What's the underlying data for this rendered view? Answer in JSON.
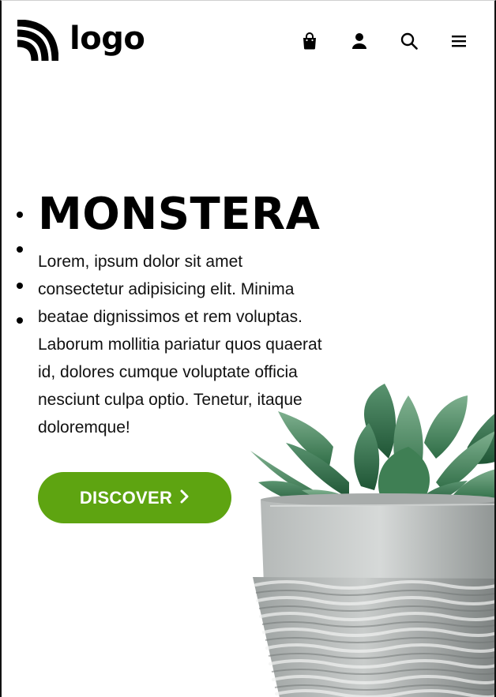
{
  "header": {
    "logo_text": "logo",
    "icons": [
      "shopping-bag-icon",
      "user-icon",
      "search-icon",
      "menu-icon"
    ]
  },
  "hero": {
    "title": "MONSTERA",
    "description": "Lorem, ipsum dolor sit amet consectetur adipisicing elit. Minima beatae dignissimos et rem voluptas. Laborum mollitia pariatur quos quaerat id, dolores cumque voluptate officia nesciunt culpa optio. Tenetur, itaque doloremque!",
    "button_label": "DISCOVER",
    "button_icon": "chevron-right-icon"
  },
  "colors": {
    "accent": "#5ea411",
    "text": "#000000",
    "background": "#ffffff"
  }
}
